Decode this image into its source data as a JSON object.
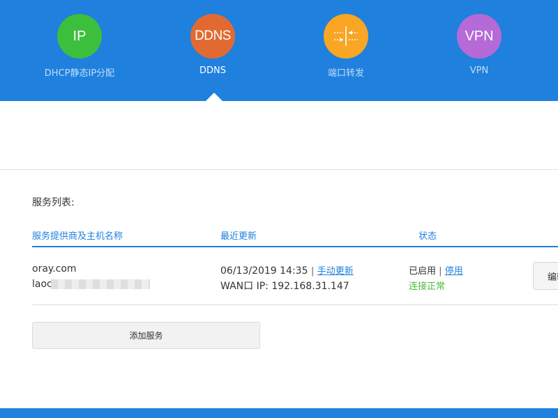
{
  "nav": {
    "items": [
      {
        "icon_text": "IP",
        "label": "DHCP静态IP分配",
        "color": "#3cbf3c",
        "active": false
      },
      {
        "icon_text": "DDNS",
        "label": "DDNS",
        "color": "#e26a32",
        "active": true
      },
      {
        "icon": "port-forward-icon",
        "label": "端口转发",
        "color": "#f8a623",
        "active": false
      },
      {
        "icon_text": "VPN",
        "label": "VPN",
        "color": "#b56ad8",
        "active": false
      }
    ]
  },
  "services": {
    "title": "服务列表:",
    "columns": [
      "服务提供商及主机名称",
      "最近更新",
      "状态"
    ],
    "rows": [
      {
        "provider": "oray.com",
        "host": "laoc",
        "update_time": "06/13/2019  14:35",
        "separator": "|",
        "manual_update": "手动更新",
        "wan_ip": "WAN口 IP:  192.168.31.147",
        "enabled": "已启用",
        "disable_link": "停用",
        "connection": "连接正常",
        "edit_label": "编辑"
      }
    ],
    "add_button": "添加服务"
  },
  "colors": {
    "primary": "#1f80de",
    "success": "#4cbb3a"
  }
}
